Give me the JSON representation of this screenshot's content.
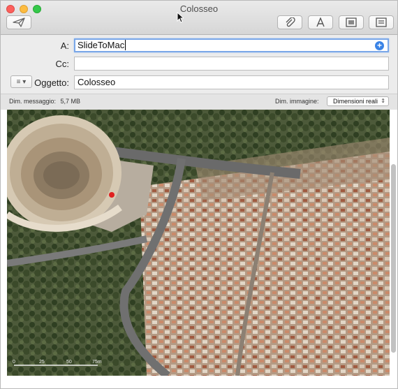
{
  "window": {
    "title": "Colosseo"
  },
  "toolbar": {
    "send_icon": "paper-plane-icon",
    "attach_icon": "paperclip-icon",
    "format_icon": "font-a-icon",
    "photo_icon": "photo-browser-icon",
    "template_icon": "stationery-icon"
  },
  "fields": {
    "to_label": "A:",
    "to_value": "SlideToMac",
    "cc_label": "Cc:",
    "cc_value": "",
    "subject_label": "Oggetto:",
    "subject_value": "Colosseo",
    "header_menu_glyph": "≡ ▾"
  },
  "infobar": {
    "size_label": "Dim. messaggio:",
    "size_value": "5,7 MB",
    "image_size_label": "Dim. immagine:",
    "image_size_selected": "Dimensioni reali"
  },
  "attachment": {
    "description": "Colosseo aerial image",
    "scale_labels": [
      "0",
      "25",
      "50",
      "75m"
    ]
  },
  "colors": {
    "close": "#fc605c",
    "minimize": "#fdbc40",
    "maximize": "#34c84a",
    "focus_ring": "#7aa7e8",
    "add_button": "#3a83e6"
  }
}
